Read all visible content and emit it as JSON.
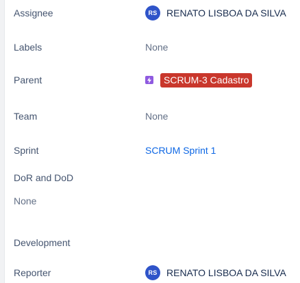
{
  "colors": {
    "avatar_bg": "#2f54c9",
    "parent_lozenge_bg": "#c9372c",
    "epic_icon_bg": "#8f5ae0",
    "link": "#0c66e4",
    "label": "#44546f"
  },
  "fields": {
    "assignee": {
      "label": "Assignee",
      "avatar_initials": "RS",
      "name": "RENATO LISBOA DA SILVA"
    },
    "labels": {
      "label": "Labels",
      "value": "None"
    },
    "parent": {
      "label": "Parent",
      "icon": "epic-lightning-icon",
      "value": "SCRUM-3 Cadastro"
    },
    "team": {
      "label": "Team",
      "value": "None"
    },
    "sprint": {
      "label": "Sprint",
      "value": "SCRUM Sprint 1"
    },
    "dor_dod": {
      "label": "DoR and DoD",
      "value": "None"
    },
    "development": {
      "label": "Development"
    },
    "reporter": {
      "label": "Reporter",
      "avatar_initials": "RS",
      "name": "RENATO LISBOA DA SILVA"
    }
  }
}
